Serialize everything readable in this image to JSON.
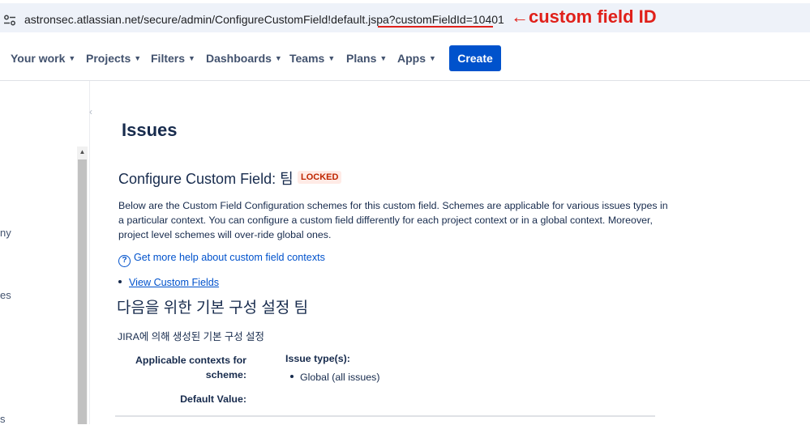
{
  "browser": {
    "url": "astronsec.atlassian.net/secure/admin/ConfigureCustomField!default.jspa?customFieldId=10401",
    "site_icon": "tune-icon"
  },
  "annotation": {
    "text": "←custom field ID",
    "color": "#e0201a"
  },
  "nav": {
    "items": [
      {
        "label": "Your work"
      },
      {
        "label": "Projects"
      },
      {
        "label": "Filters"
      },
      {
        "label": "Dashboards"
      },
      {
        "label": "Teams"
      },
      {
        "label": "Plans"
      },
      {
        "label": "Apps"
      }
    ],
    "create_label": "Create",
    "accent": "#0052cc"
  },
  "sidebar": {
    "fragments": [
      "ny",
      "es",
      "s"
    ]
  },
  "main": {
    "heading": "Issues",
    "field_title": "Configure Custom Field: 팀",
    "locked_badge": "LOCKED",
    "description": "Below are the Custom Field Configuration schemes for this custom field. Schemes are applicable for various issues types in a particular context. You can configure a custom field differently for each project context or in a global context. Moreover, project level schemes will over-ride global ones.",
    "help_link": "Get more help about custom field contexts",
    "view_link": "View Custom Fields",
    "scheme_title": "다음을 위한 기본 구성 설정 팀",
    "scheme_desc": "JIRA에 의해 생성된 기본 구성 설정",
    "contexts_label": "Applicable contexts for scheme:",
    "issue_types_label": "Issue type(s):",
    "issue_types": [
      "Global (all issues)"
    ],
    "default_value_label": "Default Value:"
  }
}
